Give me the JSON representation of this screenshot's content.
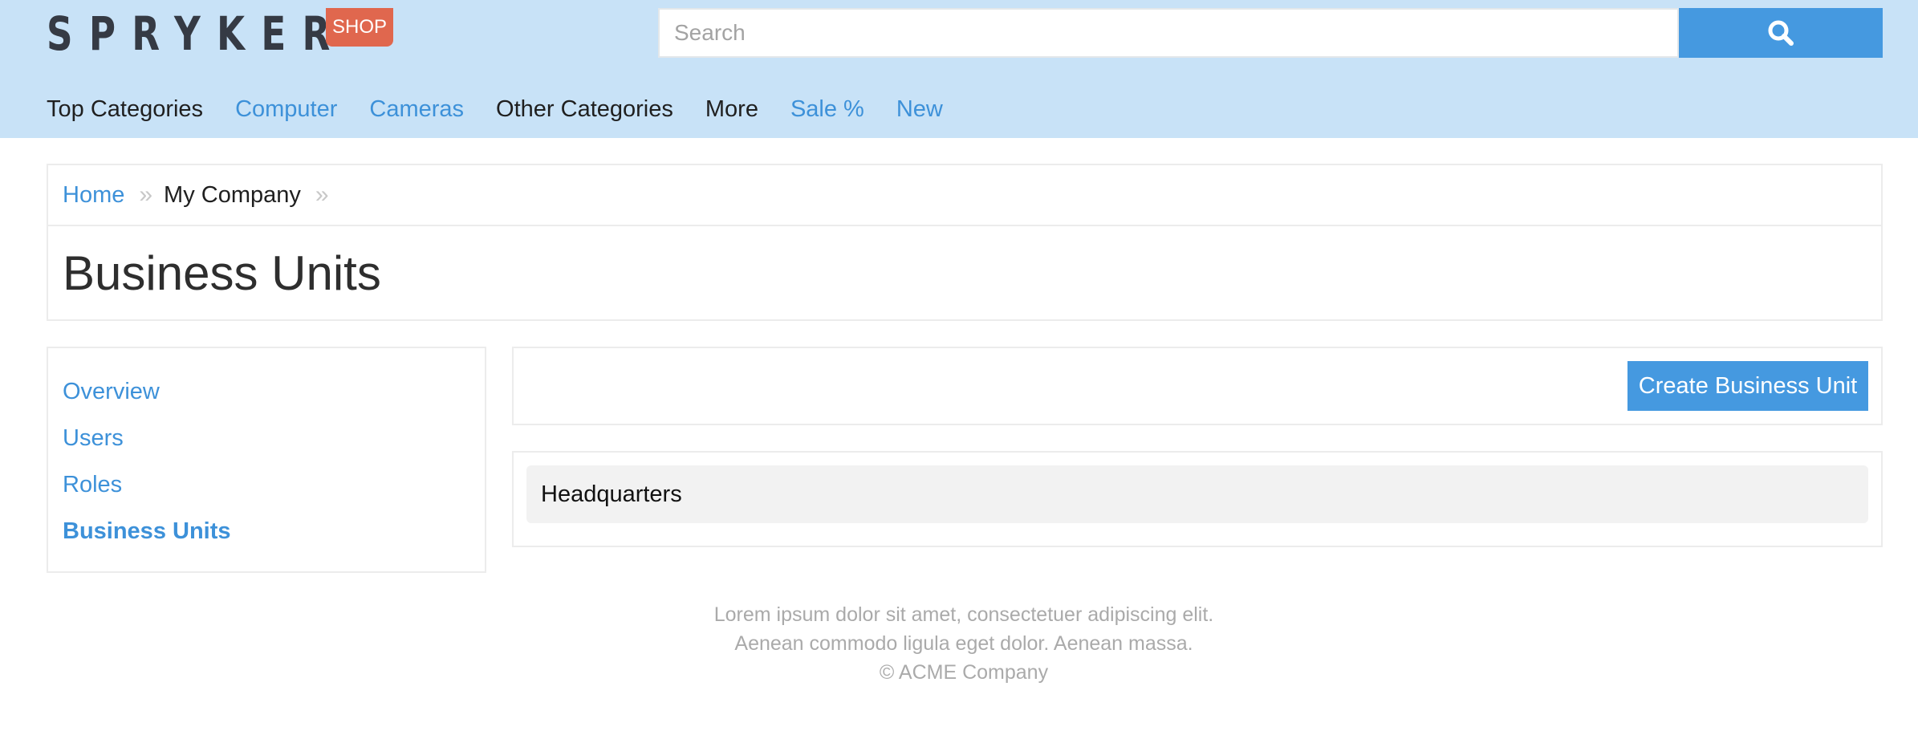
{
  "header": {
    "logo_text": "SPRYKER",
    "logo_badge": "SHOP",
    "search_placeholder": "Search",
    "search_icon": "search-icon",
    "background_color": "#c8e2f7",
    "accent_color": "#4599e0",
    "badge_color": "#e0674e"
  },
  "nav": {
    "items": [
      {
        "label": "Top Categories",
        "style": "dark"
      },
      {
        "label": "Computer",
        "style": "link"
      },
      {
        "label": "Cameras",
        "style": "link"
      },
      {
        "label": "Other Categories",
        "style": "dark"
      },
      {
        "label": "More",
        "style": "dark"
      },
      {
        "label": "Sale %",
        "style": "link"
      },
      {
        "label": "New",
        "style": "link"
      }
    ]
  },
  "breadcrumb": {
    "items": [
      "Home",
      "My Company"
    ],
    "separator": "»"
  },
  "page": {
    "title": "Business Units"
  },
  "sidebar": {
    "items": [
      {
        "label": "Overview",
        "active": false
      },
      {
        "label": "Users",
        "active": false
      },
      {
        "label": "Roles",
        "active": false
      },
      {
        "label": "Business Units",
        "active": true
      }
    ]
  },
  "actions": {
    "create_label": "Create Business Unit"
  },
  "business_units": {
    "items": [
      "Headquarters"
    ]
  },
  "footer": {
    "lines": [
      "Lorem ipsum dolor sit amet, consectetuer adipiscing elit.",
      "Aenean commodo ligula eget dolor. Aenean massa.",
      "© ACME Company"
    ]
  }
}
